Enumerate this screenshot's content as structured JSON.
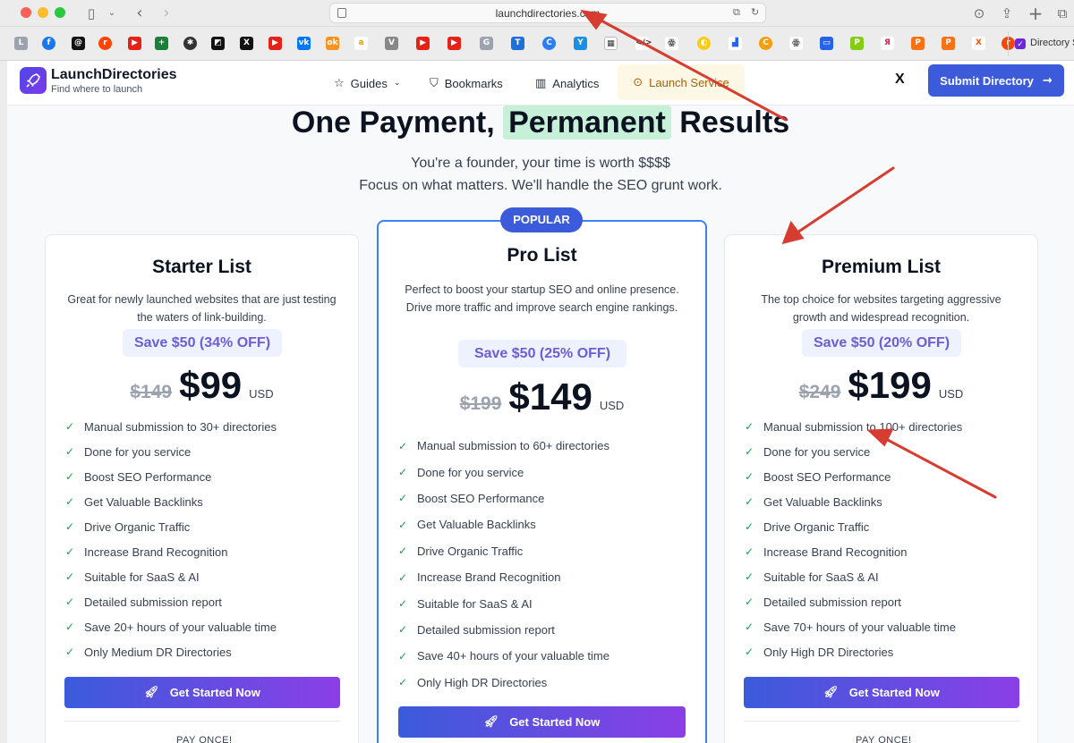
{
  "browser": {
    "url": "launchdirectories.com",
    "bookmark_label": "Directory S"
  },
  "header": {
    "logo_name": "LaunchDirectories",
    "logo_tagline": "Find where to launch",
    "nav": {
      "guides": "Guides",
      "bookmarks": "Bookmarks",
      "analytics": "Analytics",
      "launch": "Launch Service"
    },
    "x_label": "X",
    "submit_label": "Submit Directory"
  },
  "hero": {
    "title_pre": "One Payment,",
    "title_highlight": "Permanent",
    "title_post": "Results",
    "subtitle_1": "You're a founder, your time is worth $$$$",
    "subtitle_2": "Focus on what matters. We'll handle the SEO grunt work."
  },
  "popular_badge": "POPULAR",
  "plans": {
    "starter": {
      "title": "Starter List",
      "desc": "Great for newly launched websites that are just testing the waters of link-building.",
      "save": "Save $50 (34% OFF)",
      "old_price": "$149",
      "price": "$99",
      "currency": "USD",
      "features": [
        "Manual submission to 30+ directories",
        "Done for you service",
        "Boost SEO Performance",
        "Get Valuable Backlinks",
        "Drive Organic Traffic",
        "Increase Brand Recognition",
        "Suitable for SaaS & AI",
        "Detailed submission report",
        "Save 20+ hours of your valuable time",
        "Only Medium DR Directories"
      ],
      "cta": "Get Started Now",
      "footer": "PAY ONCE!"
    },
    "pro": {
      "title": "Pro List",
      "desc": "Perfect to boost your startup SEO and online presence. Drive more traffic and improve search engine rankings.",
      "save": "Save $50 (25% OFF)",
      "old_price": "$199",
      "price": "$149",
      "currency": "USD",
      "features": [
        "Manual submission to 60+ directories",
        "Done for you service",
        "Boost SEO Performance",
        "Get Valuable Backlinks",
        "Drive Organic Traffic",
        "Increase Brand Recognition",
        "Suitable for SaaS & AI",
        "Detailed submission report",
        "Save 40+ hours of your valuable time",
        "Only High DR Directories"
      ],
      "cta": "Get Started Now"
    },
    "premium": {
      "title": "Premium List",
      "desc": "The top choice for websites targeting aggressive growth and widespread recognition.",
      "save": "Save $50 (20% OFF)",
      "old_price": "$249",
      "price": "$199",
      "currency": "USD",
      "features": [
        "Manual submission to 100+ directories",
        "Done for you service",
        "Boost SEO Performance",
        "Get Valuable Backlinks",
        "Drive Organic Traffic",
        "Increase Brand Recognition",
        "Suitable for SaaS & AI",
        "Detailed submission report",
        "Save 70+ hours of your valuable time",
        "Only High DR Directories"
      ],
      "cta": "Get Started Now",
      "footer": "PAY ONCE!"
    }
  },
  "colors": {
    "accent": "#3b5bdb",
    "highlight": "#c7f0d8",
    "check": "#16a34a",
    "annotation": "#d63c2f"
  }
}
